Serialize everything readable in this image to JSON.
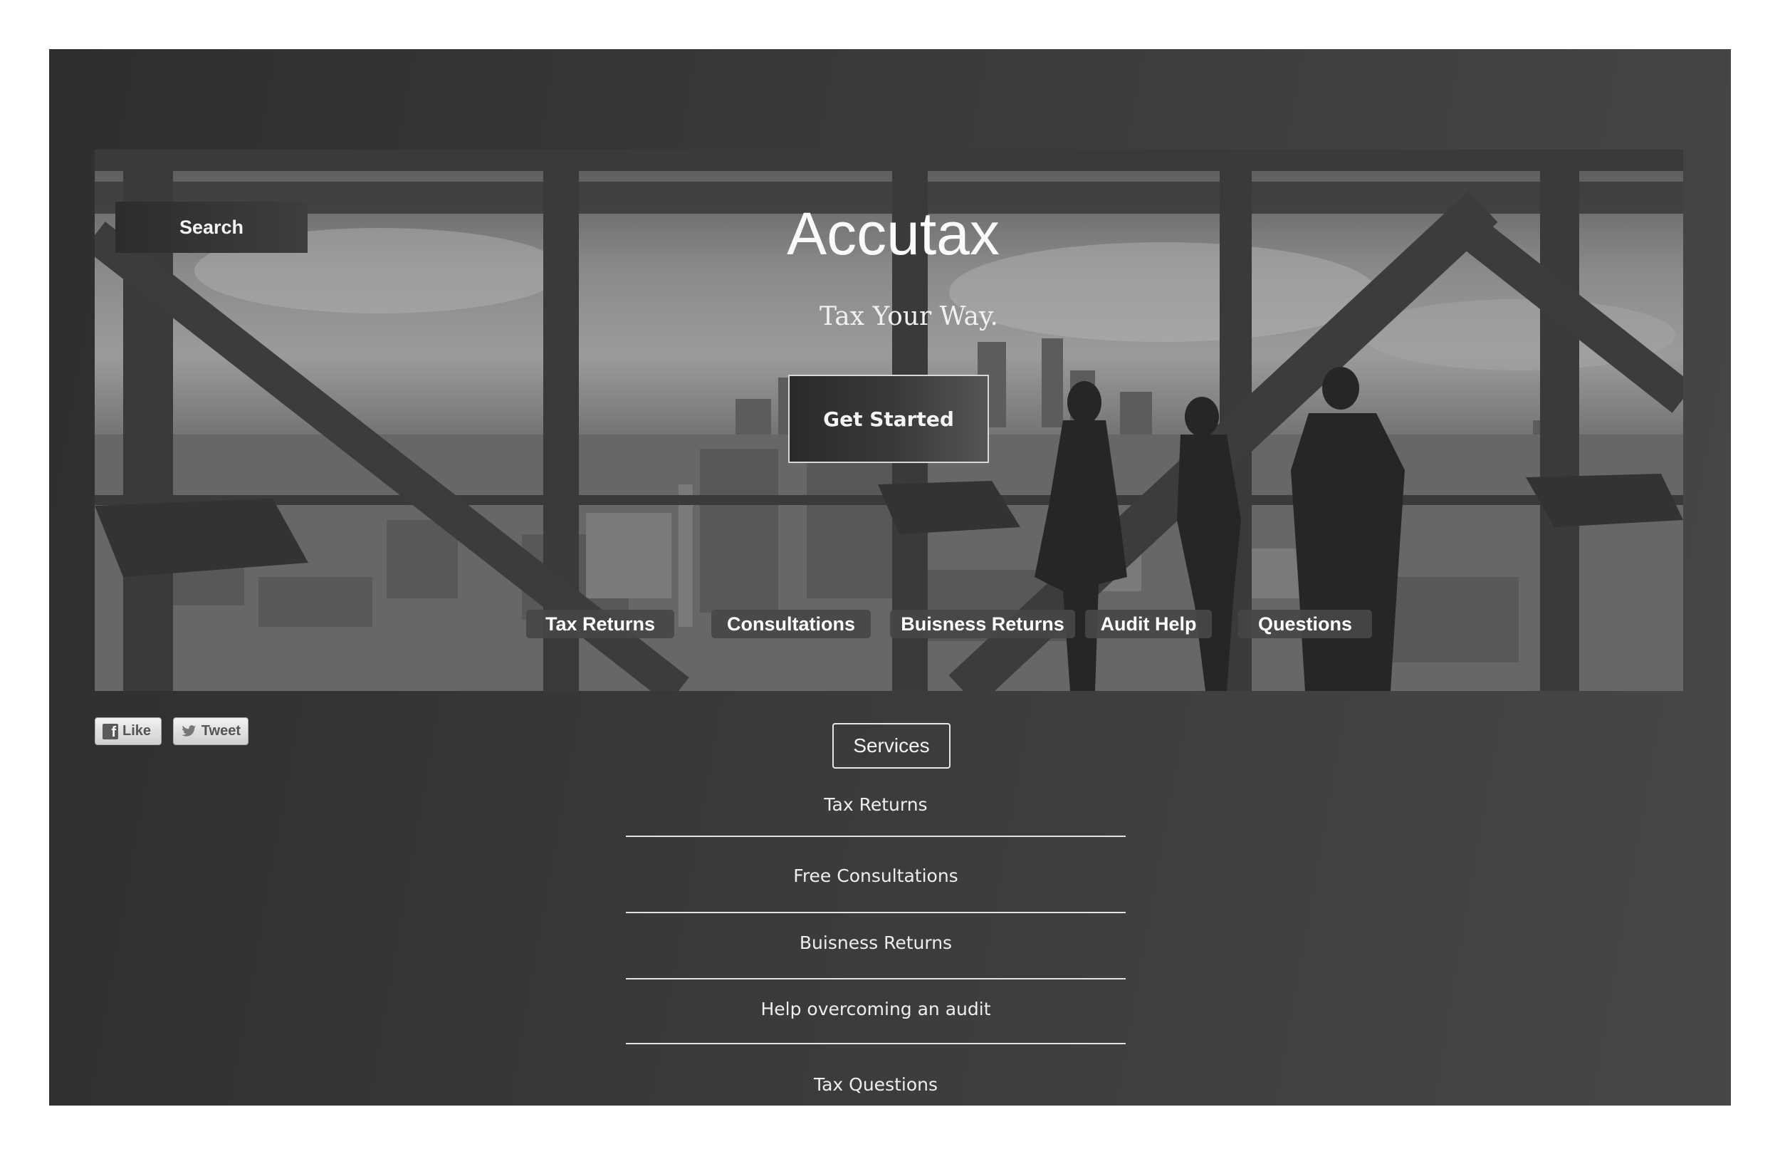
{
  "hero": {
    "search_label": "Search",
    "brand": "Accutax",
    "tagline": "Tax Your Way.",
    "cta_label": "Get Started"
  },
  "nav": [
    {
      "label": "Tax Returns"
    },
    {
      "label": "Consultations"
    },
    {
      "label": "Buisness Returns"
    },
    {
      "label": "Audit Help"
    },
    {
      "label": "Questions"
    }
  ],
  "social": {
    "like_label": "Like",
    "tweet_label": "Tweet"
  },
  "services": {
    "button_label": "Services",
    "items": [
      {
        "label": "Tax Returns"
      },
      {
        "label": "Free Consultations"
      },
      {
        "label": "Buisness Returns"
      },
      {
        "label": "Help overcoming an audit"
      },
      {
        "label": "Tax Questions"
      }
    ]
  },
  "colors": {
    "page_background": "#3a3a3a",
    "text": "#f2f2f2"
  }
}
